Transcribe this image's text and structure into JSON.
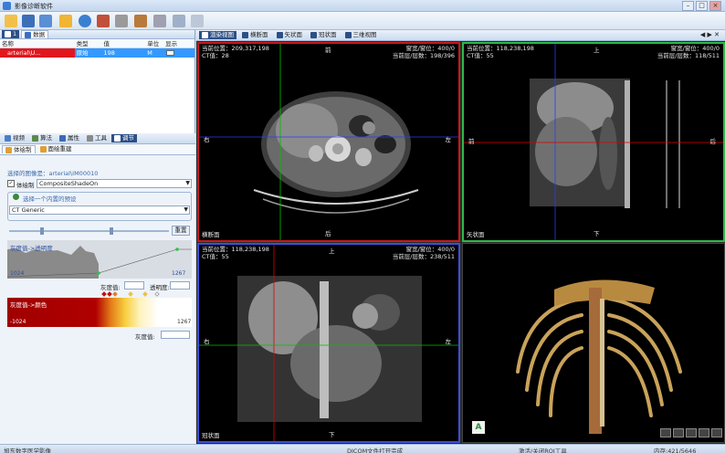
{
  "app": {
    "title": "影像诊断软件"
  },
  "toolbar": {
    "icons": [
      "open-icon",
      "save-icon",
      "export-icon",
      "folder-icon",
      "dicom-icon",
      "volume-icon",
      "brush-icon",
      "move-icon",
      "crop-icon",
      "window-icon",
      "layout-icon"
    ]
  },
  "left_tabs_top": {
    "tab1": "1",
    "tab2": "数据"
  },
  "grid": {
    "headers": [
      "名称",
      "类型",
      "值",
      "单位",
      "显示"
    ],
    "rows": [
      {
        "name": "arterial\\U...",
        "type": "原始",
        "value": "198",
        "unit": "M"
      }
    ]
  },
  "left_tabs_bottom": {
    "tab1": "视频",
    "tab2": "算法",
    "tab3": "属性",
    "tab4": "工具",
    "tab5": "调节"
  },
  "render_tabs": {
    "tab1": "体绘制",
    "tab2": "面绘重建"
  },
  "volume": {
    "selected_label": "选择的图像是：arterial\\IM00010",
    "volume_render_checkbox": "体绘制",
    "mode_select": "CompositeShadeOn",
    "preset_group_label": "选择一个内置的预设",
    "preset_select": "CT Generic",
    "reset_button": "重置",
    "opacity_curve_label": "灰度值->透明度",
    "opacity_left": "1024",
    "opacity_right": "1267",
    "gray_value_label": "灰度值:",
    "opacity_label": "透明度:",
    "color_bar_label": "灰度值->颜色",
    "color_left": "-1024",
    "color_right": "1267",
    "gray_value_label2": "灰度值:"
  },
  "view_tabs": {
    "tab1": "渲染视图",
    "tab2": "横断面",
    "tab3": "矢状面",
    "tab4": "冠状面",
    "tab5": "三维视图"
  },
  "viewports": {
    "axial": {
      "pos": "当前位置：209,317,198",
      "ct": "CT值：28",
      "wl": "窗宽/窗位：400/0",
      "slice": "当前层/层数：198/396",
      "top": "前",
      "bottom": "后",
      "left": "右",
      "right": "左",
      "name": "横断面"
    },
    "sagittal": {
      "pos": "当前位置：118,238,198",
      "ct": "CT值：55",
      "wl": "窗宽/窗位：400/0",
      "slice": "当前层/层数：118/511",
      "top": "上",
      "bottom": "下",
      "left": "前",
      "right": "后",
      "name": "矢状面"
    },
    "coronal": {
      "pos": "当前位置：118,238,198",
      "ct": "CT值：55",
      "wl": "窗宽/窗位：400/0",
      "slice": "当前层/层数：238/511",
      "top": "上",
      "bottom": "下",
      "left": "右",
      "right": "左",
      "name": "冠状面"
    }
  },
  "status": {
    "left": "旭东数字医学影像",
    "center": "DICOM文件打开完成",
    "mid": "激活/关闭ROI工具",
    "right": "内存:421/5646"
  },
  "colors": {
    "accent": "#2c4f86",
    "axial_border": "#c8191e",
    "sagittal_border": "#2fb84a",
    "coronal_border": "#3c4fd8",
    "crosshair_red": "#e00000",
    "crosshair_green": "#00c000",
    "crosshair_blue": "#2a3cff"
  }
}
